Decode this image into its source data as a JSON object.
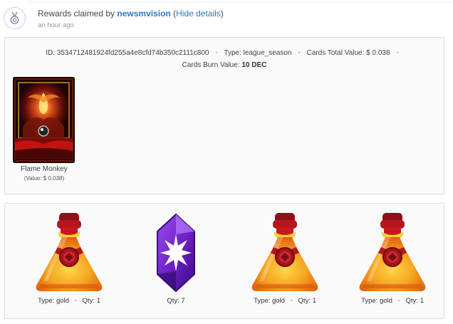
{
  "header": {
    "title_prefix": "Rewards claimed by",
    "username": "newsmvision",
    "open_paren": "(",
    "hide_details": "Hide details",
    "close_paren": ")",
    "timestamp": "an hour ago",
    "avatar_icon": "medal-icon"
  },
  "chest": {
    "id_label": "ID:",
    "id_value": "3534712481924fd255a4e8cfd74b350c2111c800",
    "type_label": "Type:",
    "type_value": "league_season",
    "total_label": "Cards Total Value:",
    "total_value": "$ 0.038",
    "burn_label": "Cards Burn Value:",
    "burn_value": "10 DEC",
    "separator": "•"
  },
  "cards": [
    {
      "name": "Flame Monkey",
      "value_text": "(Value: $ 0.038)"
    }
  ],
  "rewards": [
    {
      "icon": "potion-icon",
      "type_label": "Type:",
      "type_value": "gold",
      "qty_label": "Qty:",
      "qty_value": "1"
    },
    {
      "icon": "crystal-icon",
      "qty_label": "Qty:",
      "qty_value": "7"
    },
    {
      "icon": "potion-icon",
      "type_label": "Type:",
      "type_value": "gold",
      "qty_label": "Qty:",
      "qty_value": "1"
    },
    {
      "icon": "potion-icon",
      "type_label": "Type:",
      "type_value": "gold",
      "qty_label": "Qty:",
      "qty_value": "1"
    }
  ],
  "colors": {
    "link": "#2a78c2",
    "panel_bg": "#fafafa",
    "panel_border": "#dddddd",
    "potion_red": "#a8141b",
    "potion_orange": "#f27c1c",
    "crystal_purple": "#6a1fc2"
  }
}
